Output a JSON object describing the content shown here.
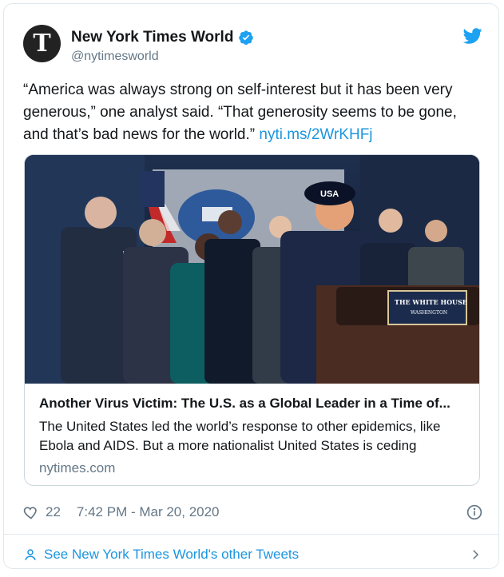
{
  "author": {
    "name": "New York Times World",
    "handle": "@nytimesworld",
    "avatar_letter": "T",
    "verified": true
  },
  "icons": {
    "verified": "verified-badge-icon",
    "twitter": "twitter-bird-icon",
    "heart": "heart-icon",
    "info": "info-icon",
    "person": "person-icon",
    "chevron": "chevron-right-icon"
  },
  "tweet": {
    "text": "“America was always strong on self-interest but it has been very generous,” one analyst said. “That generosity seems to be gone, and that’s bad news for the world.” ",
    "link_text": "nyti.ms/2WrKHFj"
  },
  "card": {
    "image_label": "USA",
    "podium_label": "THE WHITE HOUSE",
    "podium_sublabel": "WASHINGTON",
    "title": "Another Virus Victim: The U.S. as a Global Leader in a Time of...",
    "description": "The United States led the world’s response to other epidemics, like Ebola and AIDS. But a more nationalist United States is ceding",
    "domain": "nytimes.com"
  },
  "meta": {
    "likes": "22",
    "timestamp": "7:42 PM - Mar 20, 2020"
  },
  "footer": {
    "label": "See New York Times World's other Tweets"
  },
  "colors": {
    "link": "#1b95e0",
    "muted": "#657786",
    "border": "#e1e8ed"
  }
}
